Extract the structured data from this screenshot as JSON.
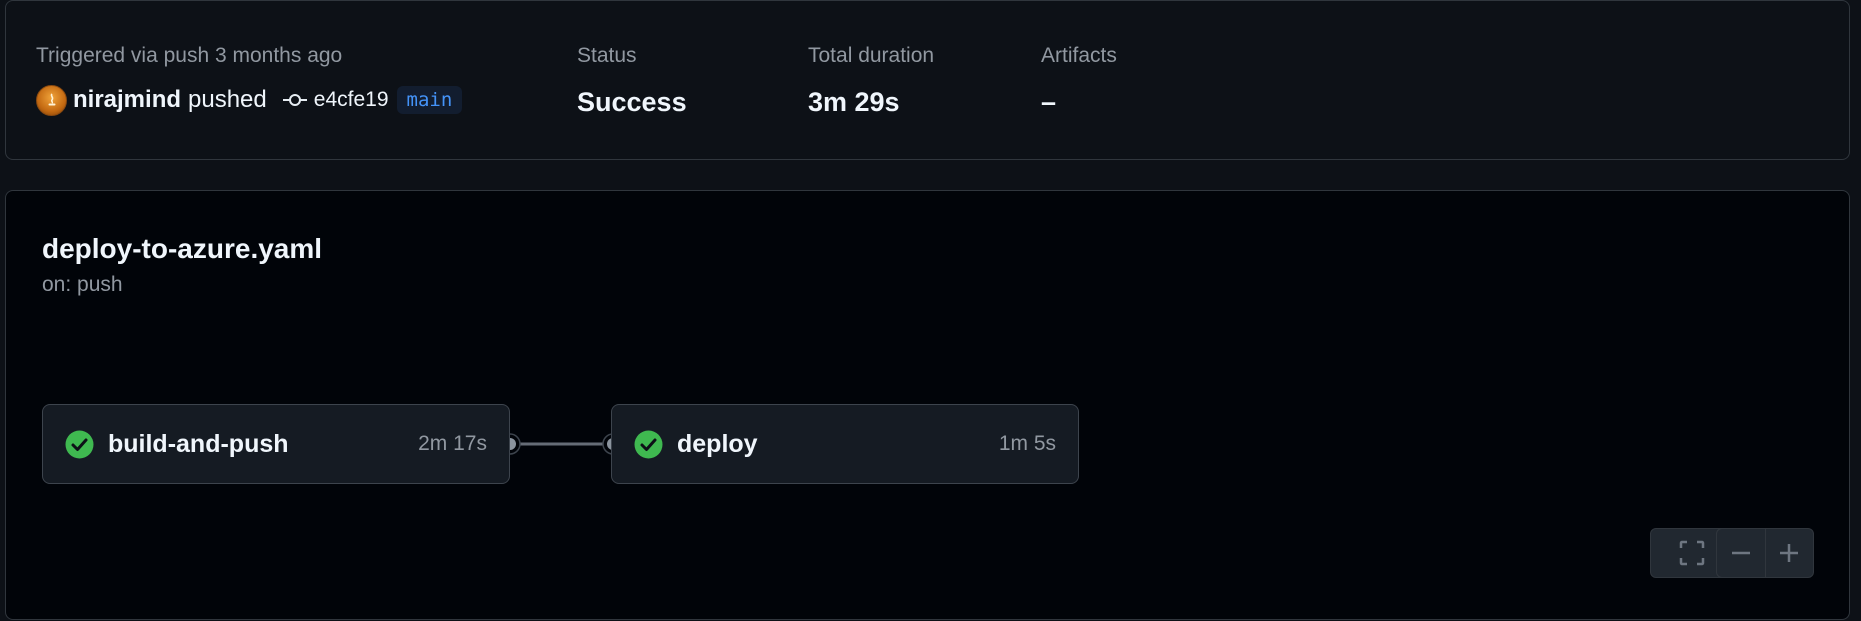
{
  "summary": {
    "trigger_label": "Triggered via push 3 months ago",
    "user": "nirajmind",
    "action": "pushed",
    "commit_sha": "e4cfe19",
    "branch": "main",
    "status_label": "Status",
    "status_value": "Success",
    "duration_label": "Total duration",
    "duration_value": "3m 29s",
    "artifacts_label": "Artifacts",
    "artifacts_value": "–"
  },
  "workflow": {
    "file": "deploy-to-azure.yaml",
    "trigger": "on: push",
    "jobs": [
      {
        "name": "build-and-push",
        "duration": "2m 17s",
        "status": "success"
      },
      {
        "name": "deploy",
        "duration": "1m 5s",
        "status": "success"
      }
    ]
  },
  "icons": {
    "avatar": "avatar-icon",
    "commit": "git-commit-icon",
    "job_status": "check-circle-fill-icon",
    "fullscreen": "screen-full-icon",
    "zoom_out": "minus-icon",
    "zoom_in": "plus-icon"
  },
  "colors": {
    "success": "#3fb950",
    "branch_text": "#4493f8",
    "branch_bg": "#121d2f",
    "muted": "#9198a1"
  }
}
